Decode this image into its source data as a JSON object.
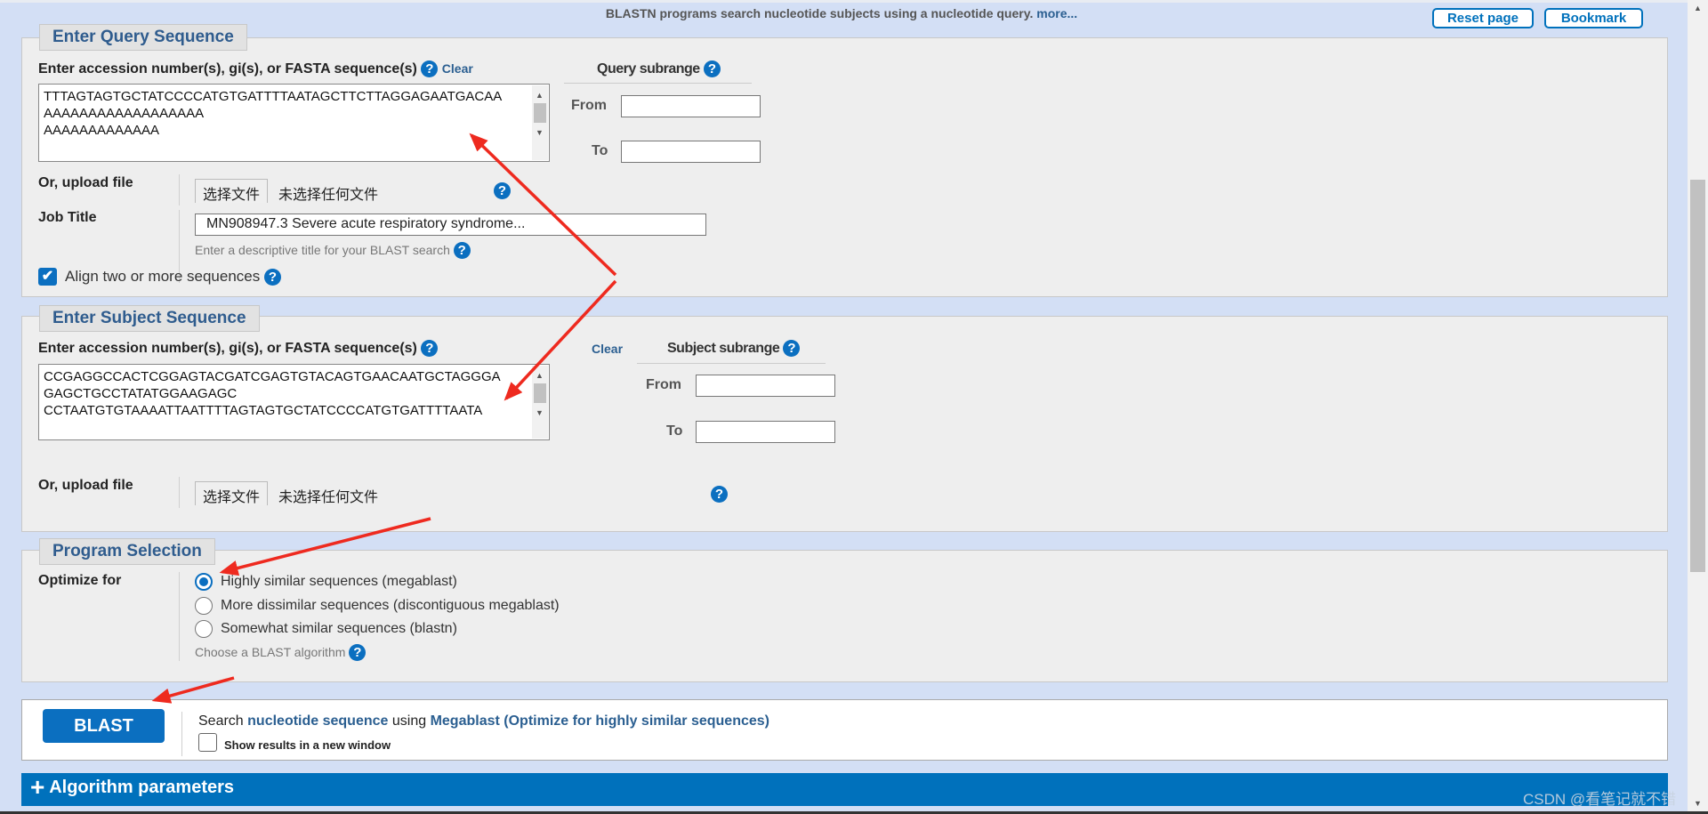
{
  "header": {
    "intro": "BLASTN programs search nucleotide subjects using a nucleotide query.",
    "more": "more...",
    "reset": "Reset page",
    "bookmark": "Bookmark"
  },
  "query": {
    "title": "Enter Query Sequence",
    "label": "Enter accession number(s), gi(s), or FASTA sequence(s)",
    "clear": "Clear",
    "sequence": "TTTAGTAGTGCTATCCCCATGTGATTTTAATAGCTTCTTAGGAGAATGACAA\nAAAAAAAAAAAAAAAAAA\nAAAAAAAAAAAAA",
    "subrange": "Query subrange",
    "from": "From",
    "to": "To",
    "upload": "Or, upload file",
    "choose": "选择文件",
    "nofile": "未选择任何文件",
    "job_label": "Job Title",
    "job_value": "MN908947.3 Severe acute respiratory syndrome...",
    "job_hint": "Enter a descriptive title for your BLAST search",
    "align": "Align two or more sequences",
    "align_checked": true
  },
  "subject": {
    "title": "Enter Subject Sequence",
    "label": "Enter accession number(s), gi(s), or FASTA sequence(s)",
    "clear": "Clear",
    "sequence": "CCGAGGCCACTCGGAGTACGATCGAGTGTACAGTGAACAATGCTAGGGA\nGAGCTGCCTATATGGAAGAGC\nCCTAATGTGTAAAATTAATTTTAGTAGTGCTATCCCCATGTGATTTTAATA",
    "subrange": "Subject subrange",
    "from": "From",
    "to": "To",
    "upload": "Or, upload file",
    "choose": "选择文件",
    "nofile": "未选择任何文件"
  },
  "program": {
    "title": "Program Selection",
    "optimize": "Optimize for",
    "options": [
      "Highly similar sequences (megablast)",
      "More dissimilar sequences (discontiguous megablast)",
      "Somewhat similar sequences (blastn)"
    ],
    "selected": 0,
    "hint": "Choose a BLAST algorithm"
  },
  "blast": {
    "button": "BLAST",
    "search": "Search",
    "db": "nucleotide sequence",
    "using": "using",
    "algo": "Megablast (Optimize for highly similar sequences)",
    "newwin": "Show results in a new window",
    "newwin_checked": false
  },
  "algorithm": {
    "label": "Algorithm parameters"
  },
  "watermark": "CSDN @看笔记就不错",
  "colors": {
    "accent": "#0071bc",
    "annotation": "#ee2a1f"
  }
}
